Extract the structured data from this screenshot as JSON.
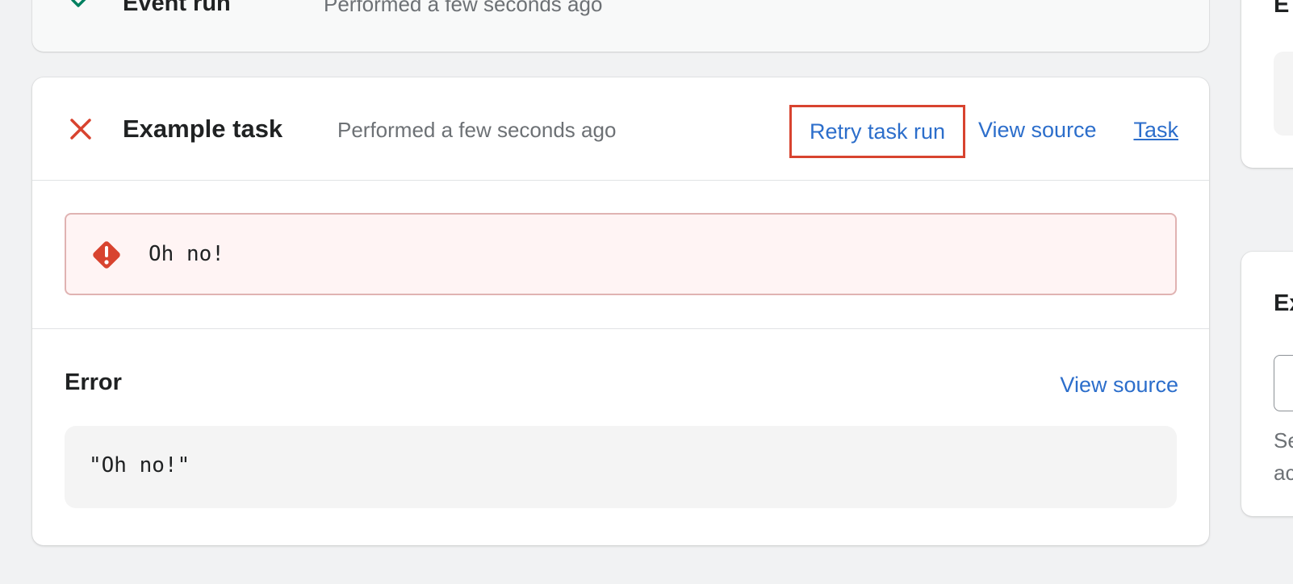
{
  "previous_event": {
    "title": "Event run",
    "time": "Performed a few seconds ago",
    "status": "success"
  },
  "task": {
    "title": "Example task",
    "time": "Performed a few seconds ago",
    "status": "failed",
    "actions": {
      "retry": "Retry task run",
      "view_source": "View source",
      "task_link": "Task"
    }
  },
  "banner": {
    "message": "Oh no!"
  },
  "error_detail": {
    "title": "Error",
    "view_source": "View source",
    "code": "\"Oh no!\""
  },
  "side": {
    "card1_title": "E",
    "card2_title": "Ex",
    "card2_help_line1": "Se",
    "card2_help_line2": "ac"
  },
  "colors": {
    "link": "#2c6ecb",
    "success": "#008060",
    "critical": "#d8432f",
    "highlight_border": "#d8432f"
  }
}
